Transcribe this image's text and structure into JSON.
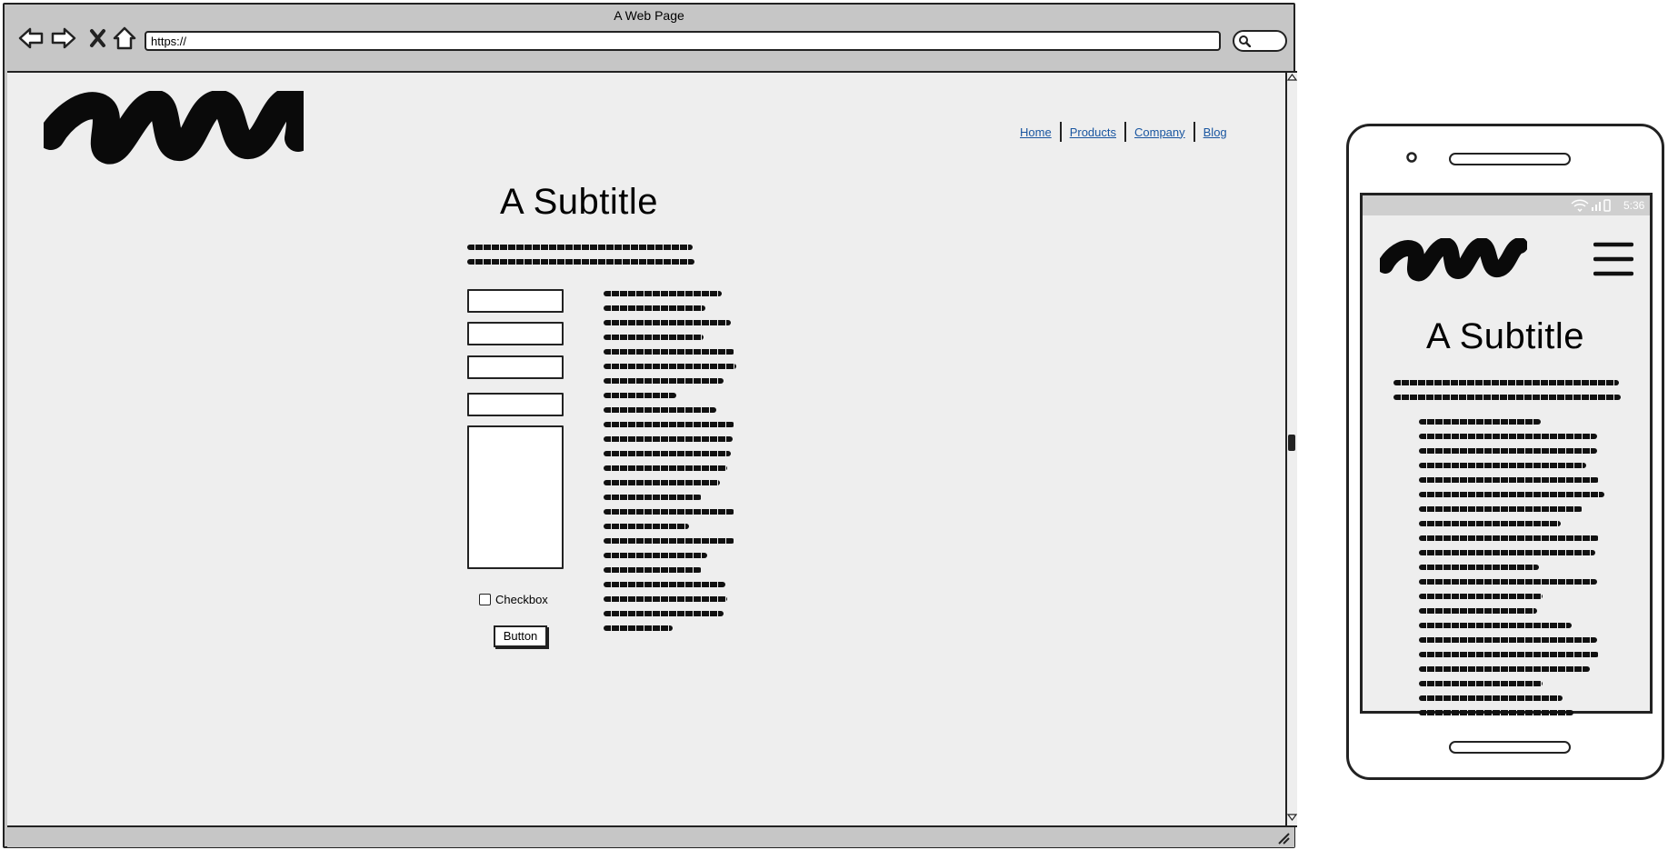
{
  "browser": {
    "title": "A Web Page",
    "url": "https://",
    "nav_icons": [
      "back-icon",
      "forward-icon",
      "close-icon",
      "home-icon"
    ],
    "search_icon": "search-icon"
  },
  "page": {
    "nav": {
      "items": [
        "Home",
        "Products",
        "Company",
        "Blog"
      ]
    },
    "subtitle": "A Subtitle",
    "form": {
      "checkbox_label": "Checkbox",
      "button_label": "Button"
    }
  },
  "phone": {
    "status_time": "5:36",
    "subtitle": "A Subtitle",
    "menu_icon": "hamburger-icon"
  },
  "colors": {
    "link": "#1a56a0",
    "canvas": "#eeeeee",
    "chrome": "#c6c6c6"
  }
}
